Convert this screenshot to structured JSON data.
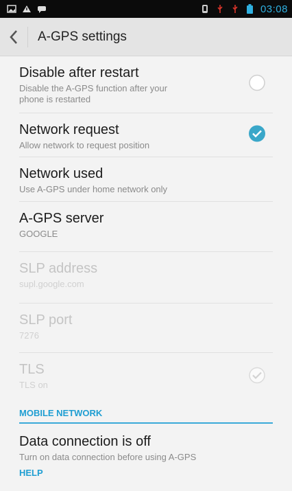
{
  "status_bar": {
    "time": "03:08",
    "left_icons": [
      "image-icon",
      "warning-icon",
      "message-icon"
    ],
    "right_icons": [
      "vibrate-icon",
      "usb-icon",
      "usb-debug-icon",
      "battery-icon"
    ]
  },
  "header": {
    "title": "A-GPS settings"
  },
  "settings": [
    {
      "title": "Disable after restart",
      "summary": "Disable the A-GPS function after your phone is restarted",
      "control": "unchecked"
    },
    {
      "title": "Network request",
      "summary": "Allow network to request position",
      "control": "checked"
    },
    {
      "title": "Network used",
      "summary": "Use A-GPS under home network only",
      "control": "none"
    },
    {
      "title": "A-GPS server",
      "summary": "GOOGLE",
      "control": "none"
    },
    {
      "title": "SLP address",
      "summary": "supl.google.com",
      "control": "none",
      "enabled": false
    },
    {
      "title": "SLP port",
      "summary": "7276",
      "control": "none",
      "enabled": false
    },
    {
      "title": "TLS",
      "summary": "TLS on",
      "control": "checked-disabled",
      "enabled": false
    }
  ],
  "section_mobile": "MOBILE NETWORK",
  "data_connection": {
    "title": "Data connection is off",
    "summary": "Turn on data connection before using A-GPS"
  },
  "section_help": "HELP",
  "colors": {
    "accent": "#39a9d8",
    "check": "#3aa7c9"
  }
}
